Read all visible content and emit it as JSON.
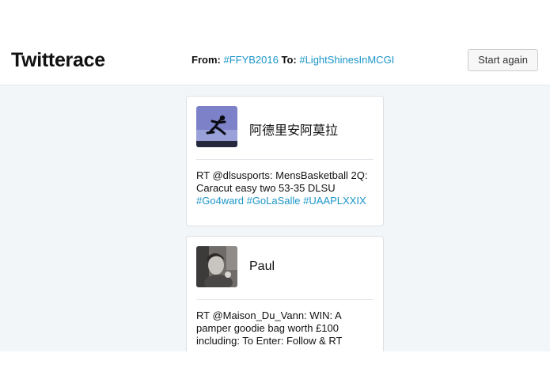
{
  "header": {
    "brand": "Twitterace",
    "from_label": "From:",
    "from_tag": "#FFYB2016",
    "to_label": "To:",
    "to_tag": "#LightShinesInMCGI",
    "start_again_label": "Start again"
  },
  "tweets": [
    {
      "user": "阿德里安阿莫拉",
      "text": "RT @dlsusports: MensBasketball 2Q: Caracut easy two 53-35 DLSU",
      "hashtags": "#Go4ward #GoLaSalle #UAAPLXXIX"
    },
    {
      "user": "Paul",
      "text": "RT @Maison_Du_Vann: WIN: A pamper goodie bag worth £100 including: To Enter: Follow & RT"
    }
  ],
  "colors": {
    "link": "#1b95c8",
    "feed_background": "#f3f6f9"
  }
}
